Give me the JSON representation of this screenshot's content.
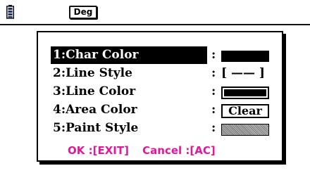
{
  "status": {
    "battery_icon": "battery-icon",
    "angle_mode": "Deg"
  },
  "menu": {
    "items": [
      {
        "label": "1:Char Color",
        "value_type": "solid-swatch",
        "selected": true
      },
      {
        "label": "2:Line Style",
        "value_text": "[ —— ]",
        "value_type": "text"
      },
      {
        "label": "3:Line Color",
        "value_type": "outlined-swatch"
      },
      {
        "label": "4:Area Color",
        "value_text": "Clear",
        "value_type": "boxed-text"
      },
      {
        "label": "5:Paint Style",
        "value_type": "pattern-swatch"
      }
    ],
    "colon": ":"
  },
  "footer": {
    "ok": "OK :[EXIT]",
    "cancel": "Cancel :[AC]"
  },
  "colors": {
    "accent": "#e0189a",
    "highlight": "#000000",
    "swatch": "#000000"
  }
}
